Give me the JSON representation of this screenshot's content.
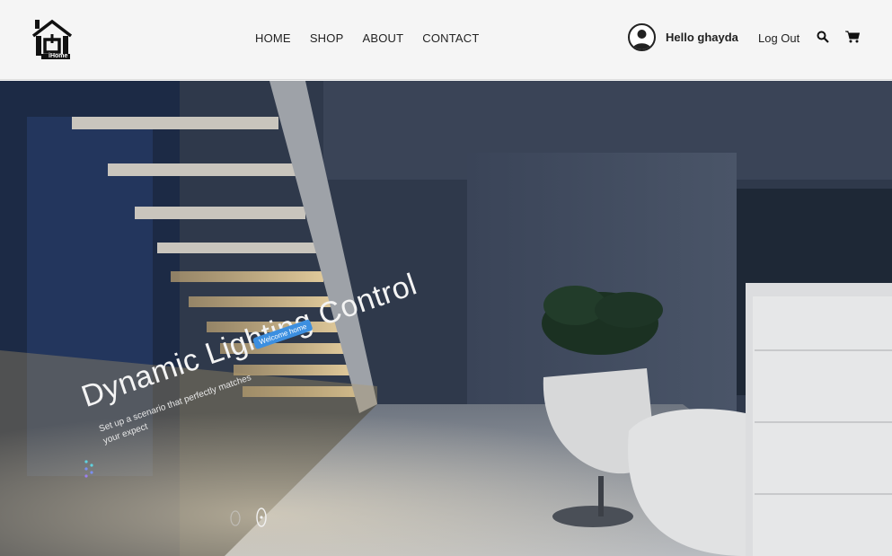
{
  "header": {
    "logo_text": "iHome",
    "nav": [
      {
        "label": "HOME"
      },
      {
        "label": "SHOP"
      },
      {
        "label": "ABOUT"
      },
      {
        "label": "CONTACT"
      }
    ],
    "greeting": "Hello ghayda",
    "logout_label": "Log Out",
    "search_icon": "search-icon",
    "cart_icon": "cart-icon"
  },
  "hero": {
    "title": "Dynamic Lighting Control",
    "subtitle": "Set up a scenario that perfectly matches your expect",
    "badge": "Welcome home"
  },
  "colors": {
    "accent": "#3c8fe0",
    "header_bg": "#f5f5f5",
    "text": "#222222"
  }
}
